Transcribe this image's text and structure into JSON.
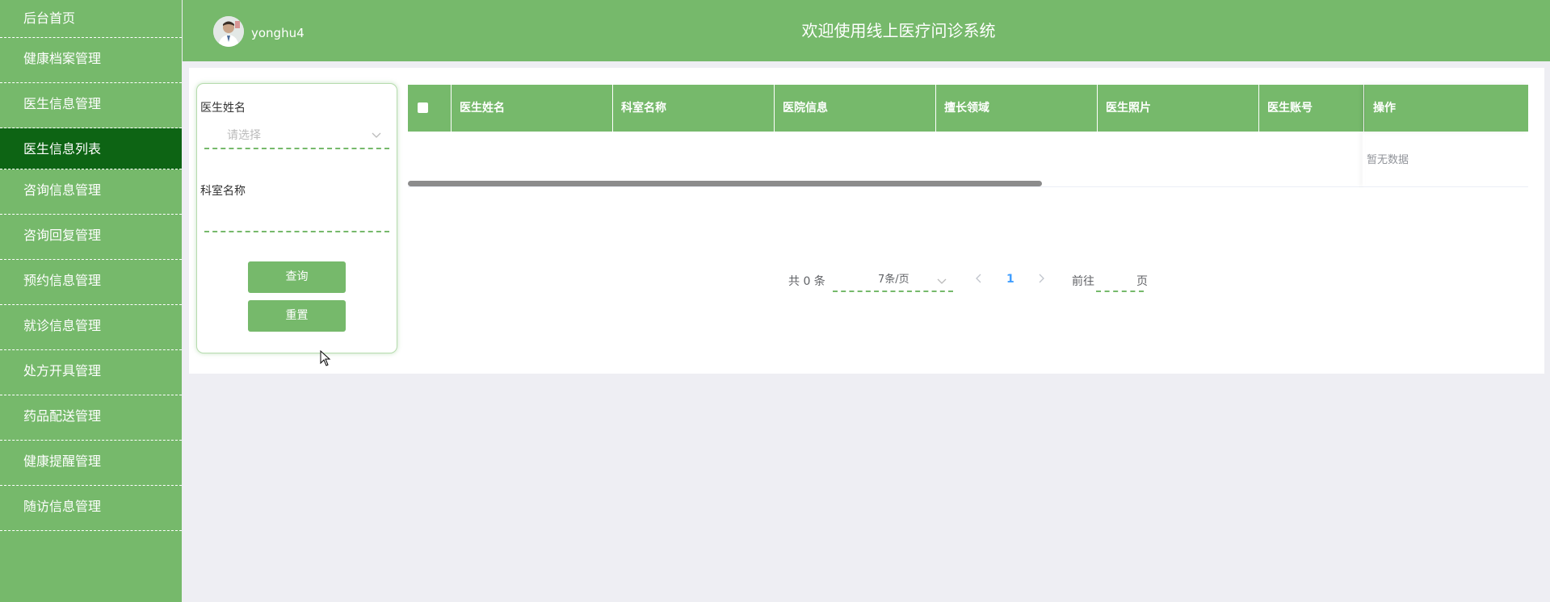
{
  "sidebar": {
    "items": [
      {
        "label": "后台首页"
      },
      {
        "label": "健康档案管理"
      },
      {
        "label": "医生信息管理"
      },
      {
        "label": "医生信息列表"
      },
      {
        "label": "咨询信息管理"
      },
      {
        "label": "咨询回复管理"
      },
      {
        "label": "预约信息管理"
      },
      {
        "label": "就诊信息管理"
      },
      {
        "label": "处方开具管理"
      },
      {
        "label": "药品配送管理"
      },
      {
        "label": "健康提醒管理"
      },
      {
        "label": "随访信息管理"
      }
    ],
    "active_index": 3
  },
  "header": {
    "username": "yonghu4",
    "title": "欢迎使用线上医疗问诊系统"
  },
  "filter": {
    "doctor_name_label": "医生姓名",
    "doctor_name_placeholder": "请选择",
    "dept_name_label": "科室名称",
    "dept_name_value": "",
    "search_button": "查询",
    "reset_button": "重置"
  },
  "table": {
    "columns": [
      "医生姓名",
      "科室名称",
      "医院信息",
      "擅长领域",
      "医生照片",
      "医生账号"
    ],
    "op_column": "操作",
    "empty_text": "暂无数据"
  },
  "pagination": {
    "total_text": "共 0 条",
    "page_size": "7条/页",
    "current_page": "1",
    "goto_label": "前往",
    "goto_suffix": "页"
  },
  "colors": {
    "primary": "#76b96b",
    "active": "#0d6414"
  }
}
